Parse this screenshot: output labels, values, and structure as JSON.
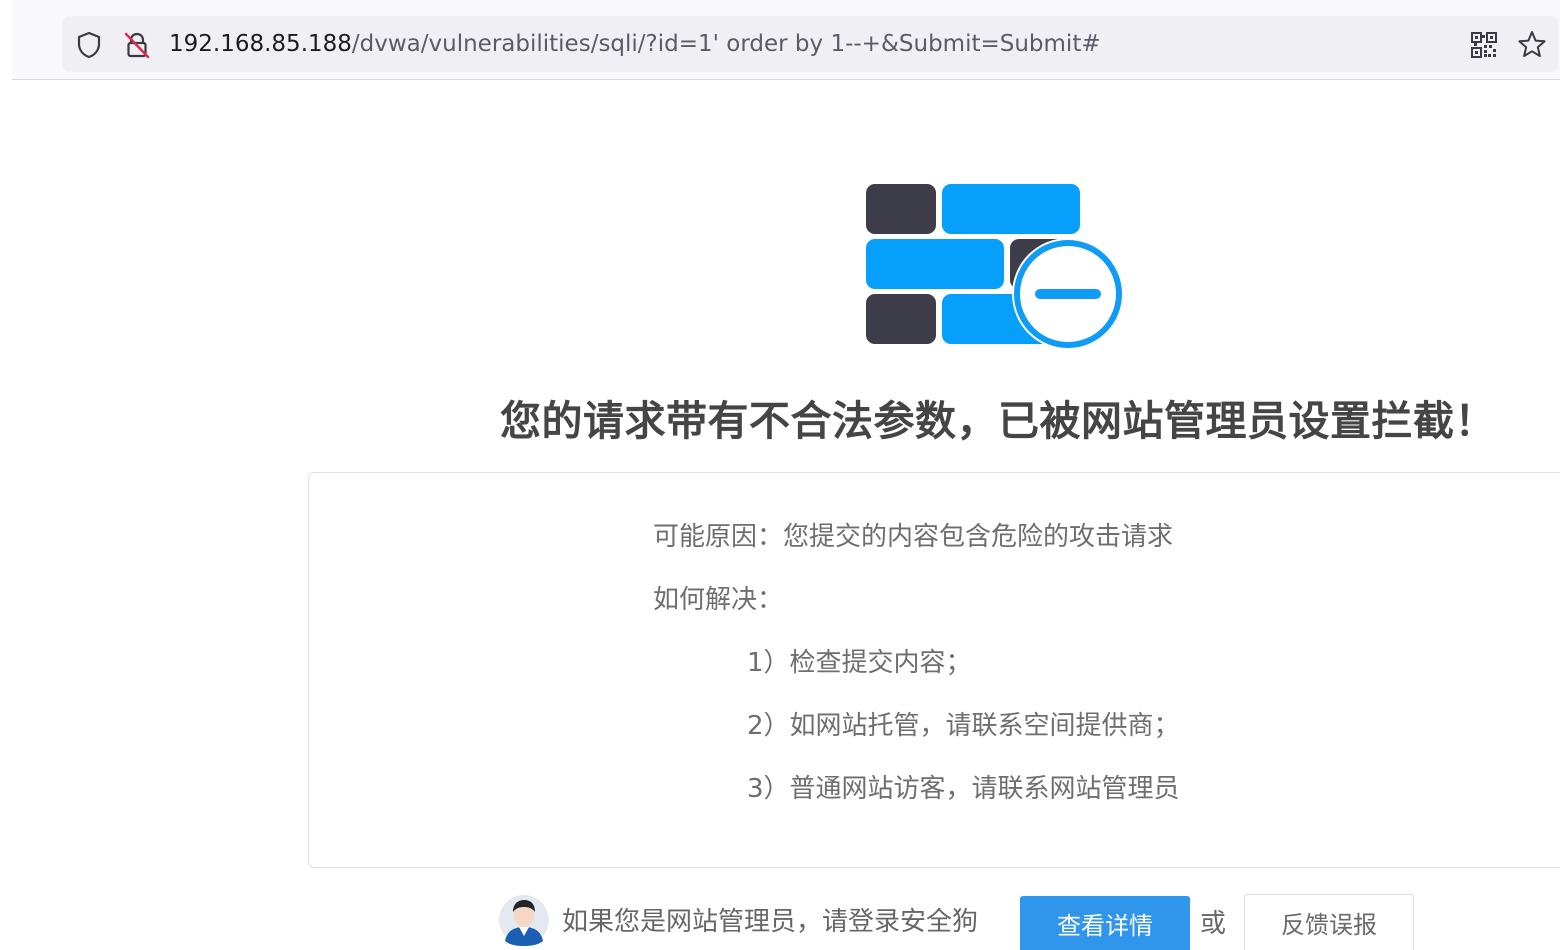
{
  "browser": {
    "url_host": "192.168.85.188",
    "url_path": "/dvwa/vulnerabilities/sqli/?id=1' order by 1--+&Submit=Submit#",
    "icons": {
      "shield": "shield-icon",
      "insecure_lock": "insecure-lock-icon",
      "qr_code": "qr-code-icon",
      "bookmark": "bookmark-star-icon"
    }
  },
  "block_page": {
    "title": "您的请求带有不合法参数，已被网站管理员设置拦截！",
    "reason": "可能原因：您提交的内容包含危险的攻击请求",
    "how_to_label": "如何解决：",
    "steps": [
      "1）检查提交内容；",
      "2）如网站托管，请联系空间提供商；",
      "3）普通网站访客，请联系网站管理员"
    ],
    "admin_prompt": "如果您是网站管理员，请登录安全狗",
    "details_button": "查看详情",
    "or_text": "或",
    "report_button": "反馈误报",
    "colors": {
      "wall_dark": "#3d3d4a",
      "wall_blue": "#069ffc",
      "block_badge": "#0f9cf6",
      "title": "#454545",
      "button_blue": "#2f96eb"
    },
    "icons": {
      "wall": "firewall-icon",
      "block": "block-minus-icon",
      "admin": "admin-avatar-icon"
    }
  }
}
